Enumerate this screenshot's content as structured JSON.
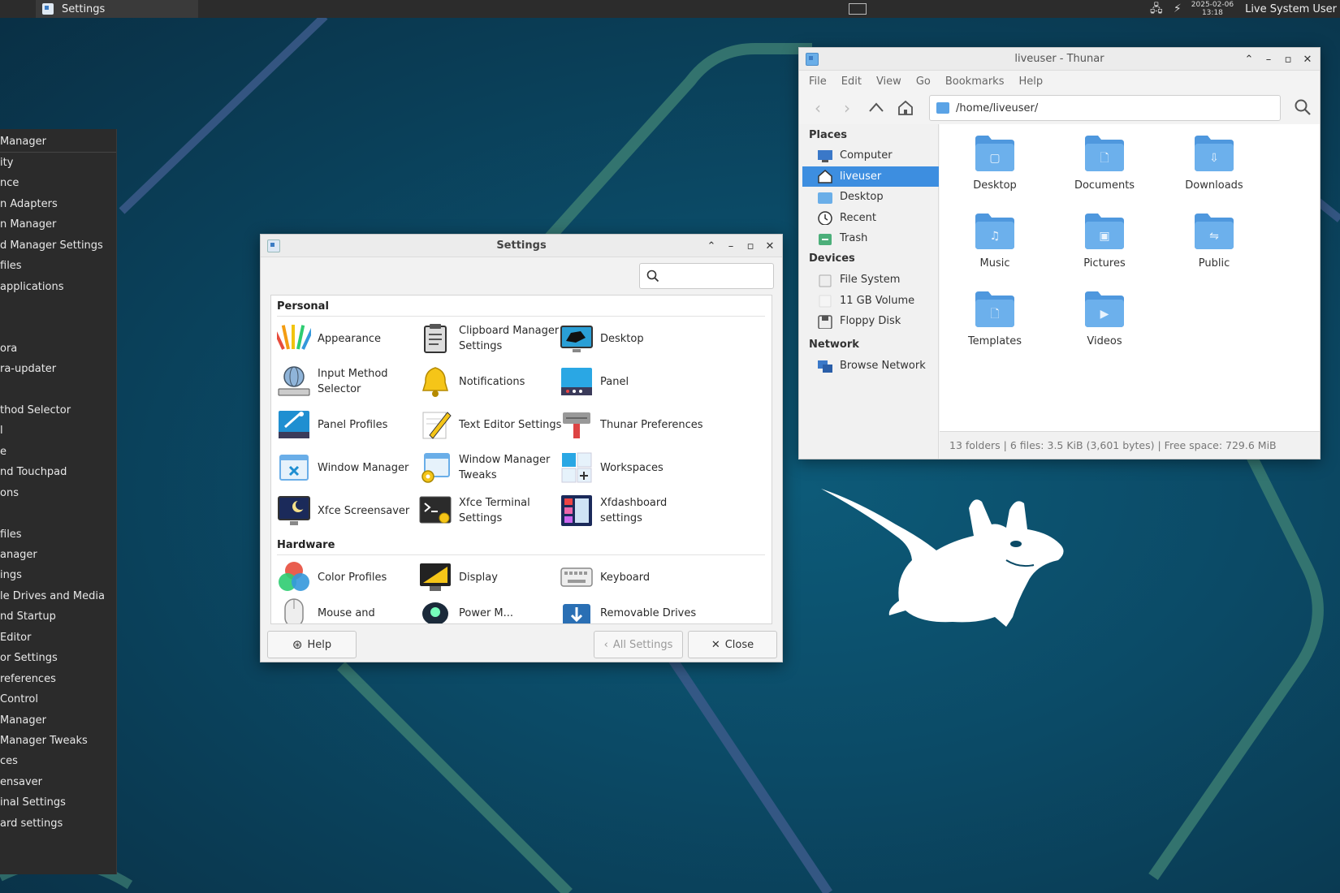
{
  "top_panel": {
    "taskbar_label": "Settings",
    "clock_date": "2025-02-06",
    "clock_time": "13:18",
    "user": "Live System User"
  },
  "left_menu": {
    "items": [
      "Manager",
      "ity",
      "nce",
      "n Adapters",
      "n Manager",
      "d Manager Settings",
      "files",
      "applications",
      "ora",
      "ra-updater",
      "thod Selector",
      "l",
      "e",
      "nd Touchpad",
      "ons",
      "files",
      "anager",
      "ings",
      "le Drives and Media",
      "nd Startup",
      "Editor",
      "or Settings",
      "references",
      "Control",
      "Manager",
      "Manager Tweaks",
      "ces",
      "ensaver",
      "inal Settings",
      "ard settings"
    ]
  },
  "settings": {
    "title": "Settings",
    "search_placeholder": "",
    "sections": [
      {
        "title": "Personal",
        "items": [
          {
            "label": "Appearance",
            "icon": "appearance-icon"
          },
          {
            "label": "Clipboard Manager Settings",
            "icon": "clipboard-icon"
          },
          {
            "label": "Desktop",
            "icon": "desktop-icon"
          },
          {
            "label": "Input Method Selector",
            "icon": "input-method-icon"
          },
          {
            "label": "Notifications",
            "icon": "bell-icon"
          },
          {
            "label": "Panel",
            "icon": "panel-icon"
          },
          {
            "label": "Panel Profiles",
            "icon": "panel-profiles-icon"
          },
          {
            "label": "Text Editor Settings",
            "icon": "text-editor-icon"
          },
          {
            "label": "Thunar Preferences",
            "icon": "thunar-prefs-icon"
          },
          {
            "label": "Window Manager",
            "icon": "window-manager-icon"
          },
          {
            "label": "Window Manager Tweaks",
            "icon": "wm-tweaks-icon"
          },
          {
            "label": "Workspaces",
            "icon": "workspaces-icon"
          },
          {
            "label": "Xfce Screensaver",
            "icon": "screensaver-icon"
          },
          {
            "label": "Xfce Terminal Settings",
            "icon": "terminal-icon"
          },
          {
            "label": "Xfdashboard settings",
            "icon": "dashboard-icon"
          }
        ]
      },
      {
        "title": "Hardware",
        "items": [
          {
            "label": "Color Profiles",
            "icon": "color-profiles-icon"
          },
          {
            "label": "Display",
            "icon": "display-icon"
          },
          {
            "label": "Keyboard",
            "icon": "keyboard-icon"
          },
          {
            "label": "Mouse and",
            "icon": "mouse-icon"
          },
          {
            "label": "Power M...",
            "icon": "power-icon"
          },
          {
            "label": "Removable Drives",
            "icon": "removable-drives-icon"
          }
        ]
      }
    ],
    "buttons": {
      "help": "Help",
      "all_settings": "All Settings",
      "close": "Close"
    }
  },
  "thunar": {
    "title": "liveuser - Thunar",
    "menu": [
      "File",
      "Edit",
      "View",
      "Go",
      "Bookmarks",
      "Help"
    ],
    "path": "/home/liveuser/",
    "side": {
      "places_title": "Places",
      "places": [
        "Computer",
        "liveuser",
        "Desktop",
        "Recent",
        "Trash"
      ],
      "devices_title": "Devices",
      "devices": [
        "File System",
        "11 GB Volume",
        "Floppy Disk"
      ],
      "network_title": "Network",
      "network": [
        "Browse Network"
      ]
    },
    "folders": [
      "Desktop",
      "Documents",
      "Downloads",
      "Music",
      "Pictures",
      "Public",
      "Templates",
      "Videos"
    ],
    "status": "13 folders  |  6 files: 3.5 KiB (3,601 bytes)  |  Free space: 729.6 MiB"
  },
  "colors": {
    "accent": "#3d8ee0",
    "folder": "#5aa3e6",
    "wallpaper": "#0b4a66"
  }
}
